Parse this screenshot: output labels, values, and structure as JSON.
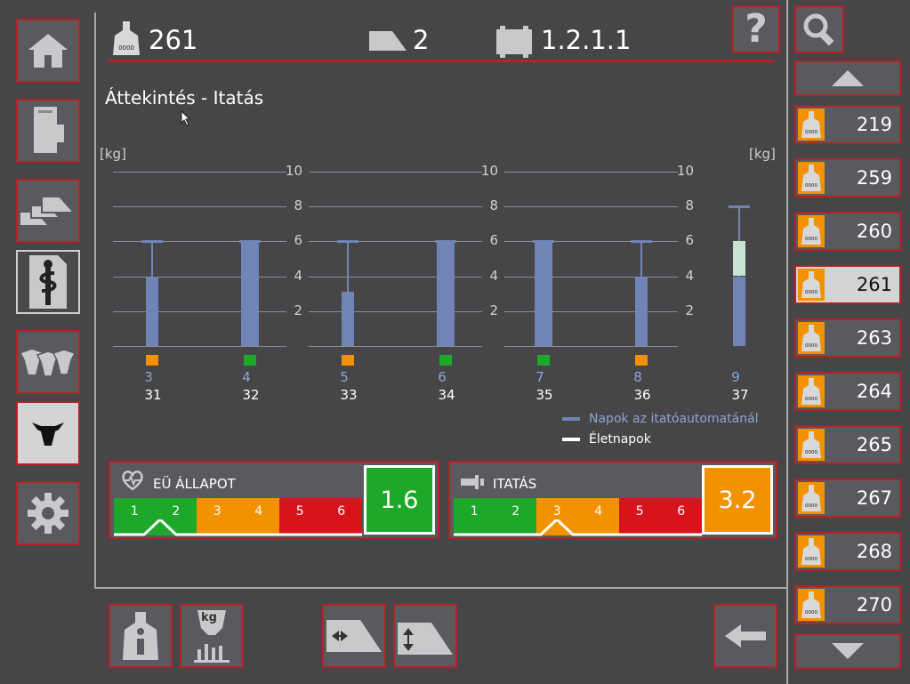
{
  "header": {
    "animal_id": "261",
    "group": "2",
    "station": "1.2.1.1"
  },
  "page_title": "Áttekintés - Itatás",
  "chart_units": {
    "left": "[kg]",
    "right": "[kg]"
  },
  "chart_data": {
    "type": "bar",
    "ylim": [
      0,
      10
    ],
    "yticks": [
      "10",
      "8",
      "6",
      "4",
      "2"
    ],
    "days": [
      {
        "visit_day": "3",
        "life_day": "31",
        "actual": 4,
        "target": 6,
        "status": "orange"
      },
      {
        "visit_day": "4",
        "life_day": "32",
        "actual": 6,
        "target": 6,
        "status": "green"
      },
      {
        "visit_day": "5",
        "life_day": "33",
        "actual": 3.1,
        "target": 6,
        "status": "orange"
      },
      {
        "visit_day": "6",
        "life_day": "34",
        "actual": 6,
        "target": 6,
        "status": "green"
      },
      {
        "visit_day": "7",
        "life_day": "35",
        "actual": 6,
        "target": 6,
        "status": "green"
      },
      {
        "visit_day": "8",
        "life_day": "36",
        "actual": 4,
        "target": 6,
        "status": "orange"
      },
      {
        "visit_day": "9",
        "life_day": "37",
        "actual": 4,
        "target": 8,
        "planned": 6,
        "status": ""
      }
    ]
  },
  "legend": {
    "visit_days": "Napok az itatóautomatánál",
    "life_days": "Életnapok"
  },
  "health_panel": {
    "title": "EÜ ÁLLAPOT",
    "value": "1.6",
    "scale": [
      "1",
      "2",
      "3",
      "4",
      "5",
      "6"
    ]
  },
  "drinking_panel": {
    "title": "ITATÁS",
    "value": "3.2",
    "scale": [
      "1",
      "2",
      "3",
      "4",
      "5",
      "6"
    ]
  },
  "animal_list": [
    "219",
    "259",
    "260",
    "261",
    "263",
    "264",
    "265",
    "267",
    "268",
    "270"
  ],
  "tag_label": "0000",
  "colors": {
    "accent_red": "#b72025",
    "green": "#1ea829",
    "orange": "#f39200",
    "red": "#d7141c",
    "bar_blue": "#7085b5",
    "planned": "#c8e3d2"
  },
  "icons": {
    "help": "?",
    "feed_kg": "kg"
  }
}
